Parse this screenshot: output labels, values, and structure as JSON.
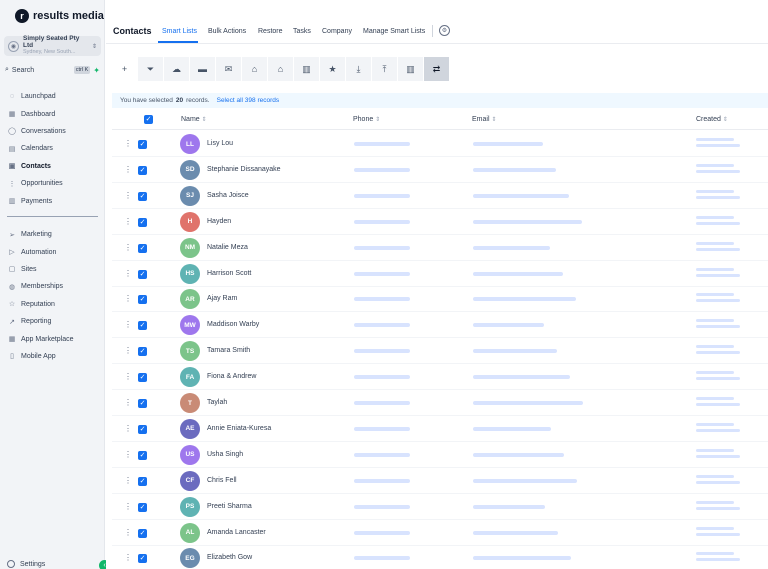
{
  "brand": {
    "logo_letter": "r",
    "name": "results media"
  },
  "account": {
    "name": "Simply Seated Pty Ltd",
    "location": "Sydney, New South..."
  },
  "search": {
    "label": "Search",
    "shortcut": "ctrl K"
  },
  "nav_top": [
    {
      "label": "Launchpad",
      "icon": "rocket-icon"
    },
    {
      "label": "Dashboard",
      "icon": "dashboard-icon"
    },
    {
      "label": "Conversations",
      "icon": "chat-icon"
    },
    {
      "label": "Calendars",
      "icon": "calendar-icon"
    },
    {
      "label": "Contacts",
      "icon": "contacts-icon",
      "active": true
    },
    {
      "label": "Opportunities",
      "icon": "opportunities-icon"
    },
    {
      "label": "Payments",
      "icon": "payments-icon"
    }
  ],
  "nav_bottom": [
    {
      "label": "Marketing",
      "icon": "send-icon"
    },
    {
      "label": "Automation",
      "icon": "automation-icon"
    },
    {
      "label": "Sites",
      "icon": "sites-icon"
    },
    {
      "label": "Memberships",
      "icon": "memberships-icon"
    },
    {
      "label": "Reputation",
      "icon": "star-icon"
    },
    {
      "label": "Reporting",
      "icon": "reporting-icon"
    },
    {
      "label": "App Marketplace",
      "icon": "marketplace-icon"
    },
    {
      "label": "Mobile App",
      "icon": "mobile-icon"
    }
  ],
  "settings_label": "Settings",
  "header": {
    "title": "Contacts",
    "tabs": [
      "Smart Lists",
      "Bulk Actions",
      "Restore",
      "Tasks",
      "Company",
      "Manage Smart Lists"
    ],
    "active_tab": "Smart Lists"
  },
  "toolbar": [
    "add-icon",
    "filter-icon",
    "cloud-icon",
    "message-icon",
    "email-icon",
    "tag-add-icon",
    "tag-remove-icon",
    "delete-icon",
    "star-icon",
    "import-icon",
    "export-icon",
    "merge-icon",
    "more-icon"
  ],
  "selection": {
    "prefix": "You have selected",
    "count": "20",
    "suffix": "records.",
    "select_all": "Select all 398 records"
  },
  "columns": {
    "name": "Name",
    "phone": "Phone",
    "email": "Email",
    "created": "Created"
  },
  "contacts": [
    {
      "initials": "LL",
      "name": "Lisy Lou",
      "color": "#9e77ed"
    },
    {
      "initials": "SD",
      "name": "Stephanie Dissanayake",
      "color": "#6b8cae"
    },
    {
      "initials": "SJ",
      "name": "Sasha Joisce",
      "color": "#6b8cae"
    },
    {
      "initials": "H",
      "name": "Hayden",
      "color": "#e0736b"
    },
    {
      "initials": "NM",
      "name": "Natalie Meza",
      "color": "#7cc48a"
    },
    {
      "initials": "HS",
      "name": "Harrison Scott",
      "color": "#5fb3b3"
    },
    {
      "initials": "AR",
      "name": "Ajay Ram",
      "color": "#7cc48a"
    },
    {
      "initials": "MW",
      "name": "Maddison Warby",
      "color": "#9e77ed"
    },
    {
      "initials": "TS",
      "name": "Tamara Smith",
      "color": "#7cc48a"
    },
    {
      "initials": "FA",
      "name": "Fiona & Andrew",
      "color": "#5fb3b3"
    },
    {
      "initials": "T",
      "name": "Taylah",
      "color": "#c98b76"
    },
    {
      "initials": "AE",
      "name": "Annie Eniata-Kuresa",
      "color": "#6b6bbf"
    },
    {
      "initials": "US",
      "name": "Usha Singh",
      "color": "#9e77ed"
    },
    {
      "initials": "CF",
      "name": "Chris Fell",
      "color": "#6b6bbf"
    },
    {
      "initials": "PS",
      "name": "Preeti Sharma",
      "color": "#5fb3b3"
    },
    {
      "initials": "AL",
      "name": "Amanda Lancaster",
      "color": "#7cc48a"
    },
    {
      "initials": "EG",
      "name": "Elizabeth Gow",
      "color": "#6b8cae"
    }
  ]
}
